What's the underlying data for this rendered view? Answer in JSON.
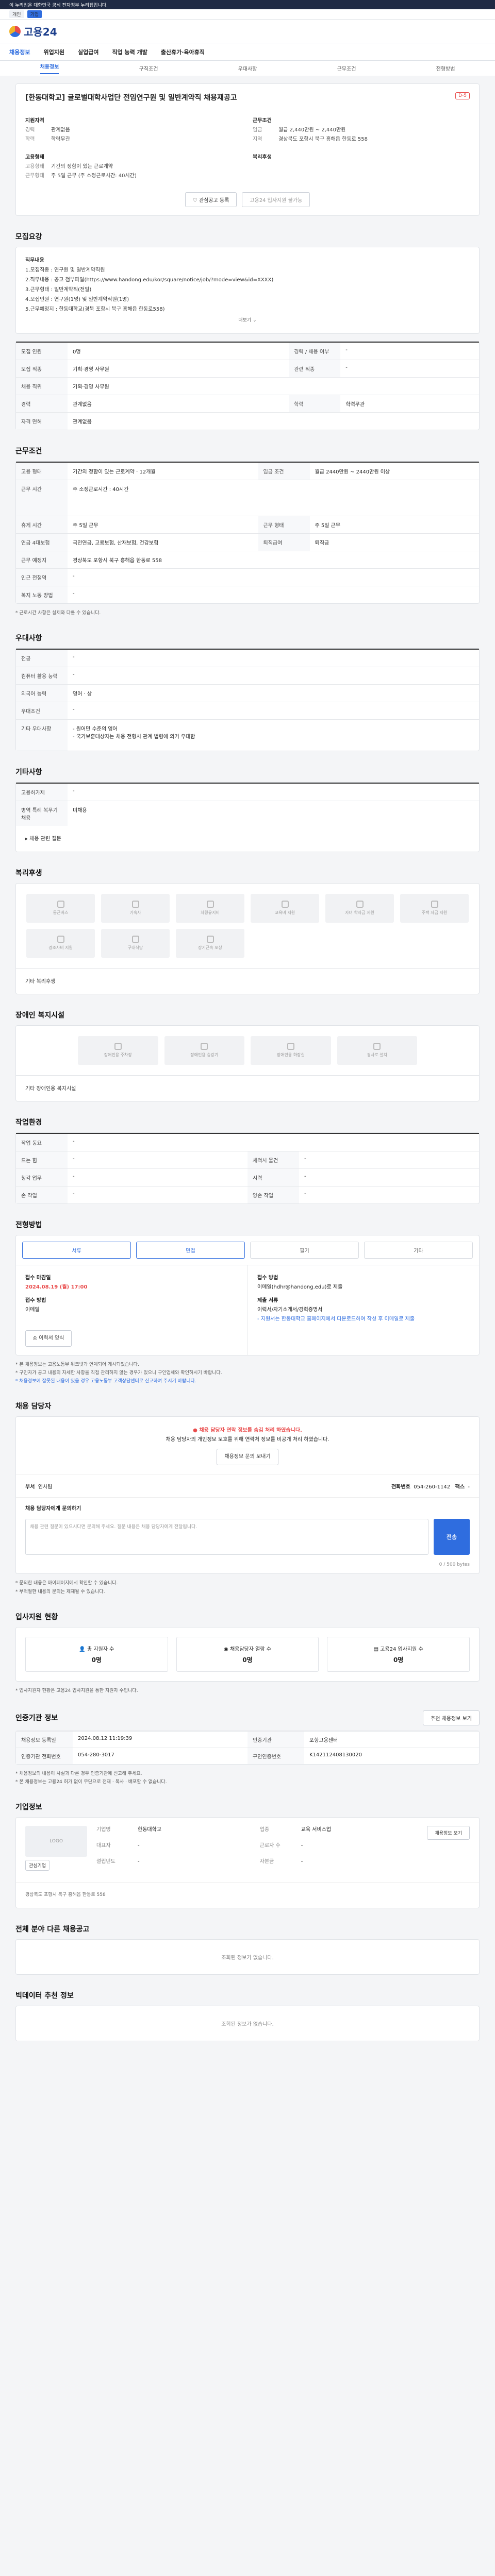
{
  "topbar": {
    "notice": "이 누리집은 대한민국 공식 전자정부 누리집입니다.",
    "tab1": "개인",
    "tab2": "기업"
  },
  "header": {
    "logo_text": "고용24"
  },
  "gnb": [
    "채용정보",
    "위업지원",
    "실업급여",
    "직업 능력 개발",
    "출산휴가·육아휴직"
  ],
  "subnav": [
    "채용정보",
    "구직조건",
    "우대사항",
    "근무조건",
    "전형방법"
  ],
  "job": {
    "title": "[한동대학교] 글로벌대학사업단 전임연구원 및 일반계약직 채용재공고",
    "badge": "D-5",
    "left_label": "지원자격",
    "right_label": "근무조건",
    "left_rows": [
      {
        "k": "경력",
        "v": "관계없음"
      },
      {
        "k": "학력",
        "v": "학력무관"
      }
    ],
    "right_rows": [
      {
        "k": "임금",
        "v": "월급 2,440만원 ~ 2,440만원"
      },
      {
        "k": "지역",
        "v": "경상북도 포항시 북구 흥해읍 한동로 558"
      }
    ],
    "left_label2": "고용형태",
    "left_rows2": [
      {
        "k": "고용형태",
        "v": "기간의 정함이 있는 근로계약"
      },
      {
        "k": "근무형태",
        "v": "주 5일 근무 (주 소정근로시간: 40시간)"
      }
    ],
    "right_label2": "복리후생",
    "btn_apply": "관심공고 등록",
    "btn_online": "고용24 입사지원 불가능"
  },
  "sec_recruit": "모집요강",
  "recruit_text": [
    "직무내용",
    "1.모집직종 : 연구원 및 일반계약직원",
    "2.직무내용 : 공고 첨부파일(https://www.handong.edu/kor/square/notice/job/?mode=view&id=XXXX)",
    "3.근무형태 : 일반계약직(전일)",
    "4.모집인원 : 연구원(1명) 및 일반계약직원(1명)",
    "5.근무예정지 : 한동대학교(경북 포항시 북구 흥해읍 한동로558)"
  ],
  "more_label": "더보기",
  "recruit_table": [
    {
      "k1": "모집 인원",
      "v1": "0명",
      "k2": "경력 / 채용 여부",
      "v2": "-"
    },
    {
      "k1": "모집 직종",
      "v1": "기획·경영 사무원",
      "k2": "관련 직종",
      "v2": "-"
    },
    {
      "k1": "채용 직위",
      "v1": "기획·경영 사무원",
      "k2": "",
      "v2": ""
    },
    {
      "k1": "경력",
      "v1": "관계없음",
      "k2": "학력",
      "v2": "학력무관"
    },
    {
      "k1": "자격 면허",
      "v1": "관계없음",
      "k2": "",
      "v2": ""
    }
  ],
  "sec_condition": "근무조건",
  "condition_table": [
    {
      "k1": "고용 형태",
      "v1": "기간의 정함이 있는 근로계약 · 12개월",
      "k2": "임금 조건",
      "v2": "월급 2440만원 ~ 2440만원 이상"
    },
    {
      "k1": "근무 시간",
      "v1": "주 소정근로시간 : 40시간",
      "k2": "",
      "v2": ""
    },
    {
      "k1": "휴게 시간",
      "v1": "주 5일 근무",
      "k2": "근무 형태",
      "v2": "주 5일 근무"
    },
    {
      "k1": "연금 4대보험",
      "v1": "국민연금, 고용보험, 산재보험, 건강보험",
      "k2": "퇴직급여",
      "v2": "퇴직금"
    },
    {
      "k1": "근무 예정지",
      "v1": "경상북도 포항시 북구 흥해읍 한동로 558",
      "k2": "",
      "v2": ""
    },
    {
      "k1": "인근 전철역",
      "v1": "-",
      "k2": "",
      "v2": ""
    },
    {
      "k1": "복지 노동 방법",
      "v1": "-",
      "k2": "",
      "v2": ""
    }
  ],
  "condition_note": "* 근로시간 사항은 실제와 다를 수 있습니다.",
  "sec_pref": "우대사항",
  "pref_table": [
    {
      "k": "전공",
      "v": "-"
    },
    {
      "k": "컴퓨터 활용 능력",
      "v": "-"
    },
    {
      "k": "외국어 능력",
      "v": "영어 · 상"
    },
    {
      "k": "우대조건",
      "v": "-"
    },
    {
      "k": "기타 우대사항",
      "v": "- 원어민 수준의 영어\n- 국가보훈대상자는 채용 전형시 관계 법령에 의거 우대함"
    }
  ],
  "sec_etc": "기타사항",
  "etc_table": [
    {
      "k": "고용허가제",
      "v": "-"
    },
    {
      "k": "병역 특례 복무기 채용",
      "v": "미채용"
    }
  ],
  "etc_extra": "채용 관련 질문",
  "sec_welfare": "복리후생",
  "welfare_tiles": [
    "통근버스",
    "기숙사",
    "차량유지비",
    "교육비 지원",
    "자녀 학자금 지원",
    "주택 자금 지원",
    "경조사비 지원",
    "구내식당",
    "장기근속 포상"
  ],
  "welfare_etc": "기타 복리후생",
  "sec_disabled": "장애인 복지시설",
  "disabled_tiles": [
    "장애인용 주차장",
    "장애인용 승강기",
    "장애인용 화장실",
    "경사로 설치"
  ],
  "disabled_etc": "기타 장애인용 복지시설",
  "sec_workenv": "작업환경",
  "workenv_table": [
    {
      "k1": "작업 동요",
      "v1": "-",
      "k2": "",
      "v2": ""
    },
    {
      "k1": "드는 힘",
      "v1": "-",
      "k2": "세척시 물건",
      "v2": "-"
    },
    {
      "k1": "청각 업무",
      "v1": "-",
      "k2": "시력",
      "v2": "-"
    },
    {
      "k1": "손 작업",
      "v1": "-",
      "k2": "양손 작업",
      "v2": "-"
    }
  ],
  "sec_method": "전형방법",
  "method_tiles": [
    "서류",
    "면접",
    "필기",
    "기타"
  ],
  "method_left": {
    "k1": "접수 마감일",
    "v1": "2024.08.19 (월) 17:00",
    "k2": "접수 방법",
    "v2": "이메일",
    "btn": "이력서 양식"
  },
  "method_right": {
    "k1": "접수 방법",
    "v1": "이메일(hdhr@handong.edu)로 제출",
    "k2": "제출 서류",
    "v2": "이력서/자기소개서/경력증명서",
    "extra": "- 지원서는 한동대학교 홈페이지에서 다운로드하여 작성 후 이메일로 제출"
  },
  "method_notice": [
    "* 본 채용정보는 고용노동부 워크넷과 연계되어 게시되었습니다.",
    "* 구인자가 공고 내용의 자세한 사항을 직접 관리하지 않는 경우가 있으니 구인업체와 확인하시기 바랍니다.",
    "* 채용정보에 잘못된 내용이 있을 경우 고용노동부 고객상담센터로 신고하여 주시기 바랍니다."
  ],
  "sec_contact": "채용 담당자",
  "alert_text1": "채용 담당자 연락 정보를 숨김 처리 하였습니다.",
  "alert_text2": "채용 담당자의 개인정보 보호를 위해 연락처 정보를 비공개 처리 하였습니다.",
  "alert_btn": "채용정보 문의 보내기",
  "contact_dept_k": "부서",
  "contact_dept_v": "인사팀",
  "contact_phone_k": "전화번호",
  "contact_phone_v": "054-260-1142",
  "contact_fax_k": "팩스",
  "contact_fax_v": "-",
  "inquiry_label": "채용 담당자에게 문의하기",
  "inquiry_placeholder": "채용 관련 질문이 있으시다면 문의해 주세요. 질문 내용은 채용 담당자에게 전달됩니다.",
  "inquiry_send": "전송",
  "inquiry_counter": "0 / 500 bytes",
  "inquiry_notes": [
    "* 문의한 내용은 마이페이지에서 확인할 수 있습니다.",
    "* 부적절한 내용의 문의는 제재될 수 있습니다."
  ],
  "sec_stats": "입사지원 현황",
  "stats": [
    {
      "label": "총 지원자 수",
      "value": "0명"
    },
    {
      "label": "채용담당자 열람 수",
      "value": "0명"
    },
    {
      "label": "고용24 입사지원 수",
      "value": "0명"
    }
  ],
  "stats_note": "* 입사지원자 현황은 고용24 입사지원을 통한 지원자 수입니다.",
  "sec_info": "인증기관 정보",
  "info_btn": "추천 채용정보 보기",
  "info_grid": [
    {
      "k1": "채용정보 등록일",
      "v1": "2024.08.12 11:19:39",
      "k2": "인증기관",
      "v2": "포항고용센터"
    },
    {
      "k1": "인증기관 전화번호",
      "v1": "054-280-3017",
      "k2": "구인인증번호",
      "v2": "K142112408130020"
    }
  ],
  "info_notes": [
    "* 채용정보의 내용이 사실과 다른 경우 인증기관에 신고해 주세요.",
    "* 본 채용정보는 고용24 허가 없이 무단으로 전재 · 복사 · 배포할 수 없습니다."
  ],
  "sec_company": "기업정보",
  "company": {
    "logo": "LOGO",
    "btn_a": "관심기업",
    "btn_b": "채용정보 보기",
    "rows": [
      {
        "k": "기업명",
        "v": "한동대학교"
      },
      {
        "k": "업종",
        "v": "교육 서비스업"
      },
      {
        "k": "대표자",
        "v": "-"
      },
      {
        "k": "근로자 수",
        "v": "-"
      },
      {
        "k": "설립년도",
        "v": "-"
      },
      {
        "k": "자본금",
        "v": "-"
      }
    ],
    "address": "경상북도 포항시 북구 흥해읍 한동로 558"
  },
  "sec_same": "전체 분야 다른 채용공고",
  "same_empty": "조회된 정보가 없습니다.",
  "sec_recommend": "빅데이터 추천 정보",
  "recommend_empty": "조회된 정보가 없습니다."
}
